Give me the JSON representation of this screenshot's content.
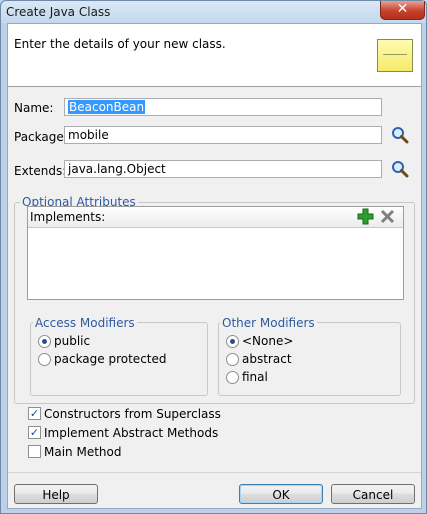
{
  "window": {
    "title": "Create Java Class",
    "close_label": "✕"
  },
  "header": {
    "instruction": "Enter the details of your new class."
  },
  "form": {
    "name_label": "Name:",
    "name_value": "BeaconBean",
    "package_label": "Package:",
    "package_value": "mobile",
    "extends_label": "Extends:",
    "extends_value": "java.lang.Object"
  },
  "optional": {
    "legend": "Optional Attributes",
    "implements_label": "Implements:"
  },
  "access": {
    "legend": "Access Modifiers",
    "options": [
      {
        "label": "public",
        "selected": true
      },
      {
        "label": "package protected",
        "selected": false
      }
    ]
  },
  "other": {
    "legend": "Other Modifiers",
    "options": [
      {
        "label": "<None>",
        "selected": true
      },
      {
        "label": "abstract",
        "selected": false
      },
      {
        "label": "final",
        "selected": false
      }
    ]
  },
  "checks": [
    {
      "label": "Constructors from Superclass",
      "checked": true
    },
    {
      "label": "Implement Abstract Methods",
      "checked": true
    },
    {
      "label": "Main Method",
      "checked": false
    }
  ],
  "buttons": {
    "help": "Help",
    "ok": "OK",
    "cancel": "Cancel"
  },
  "colors": {
    "legend_text": "#2d5aa0",
    "selection": "#3399ff",
    "add_icon": "#2e9e2e"
  }
}
